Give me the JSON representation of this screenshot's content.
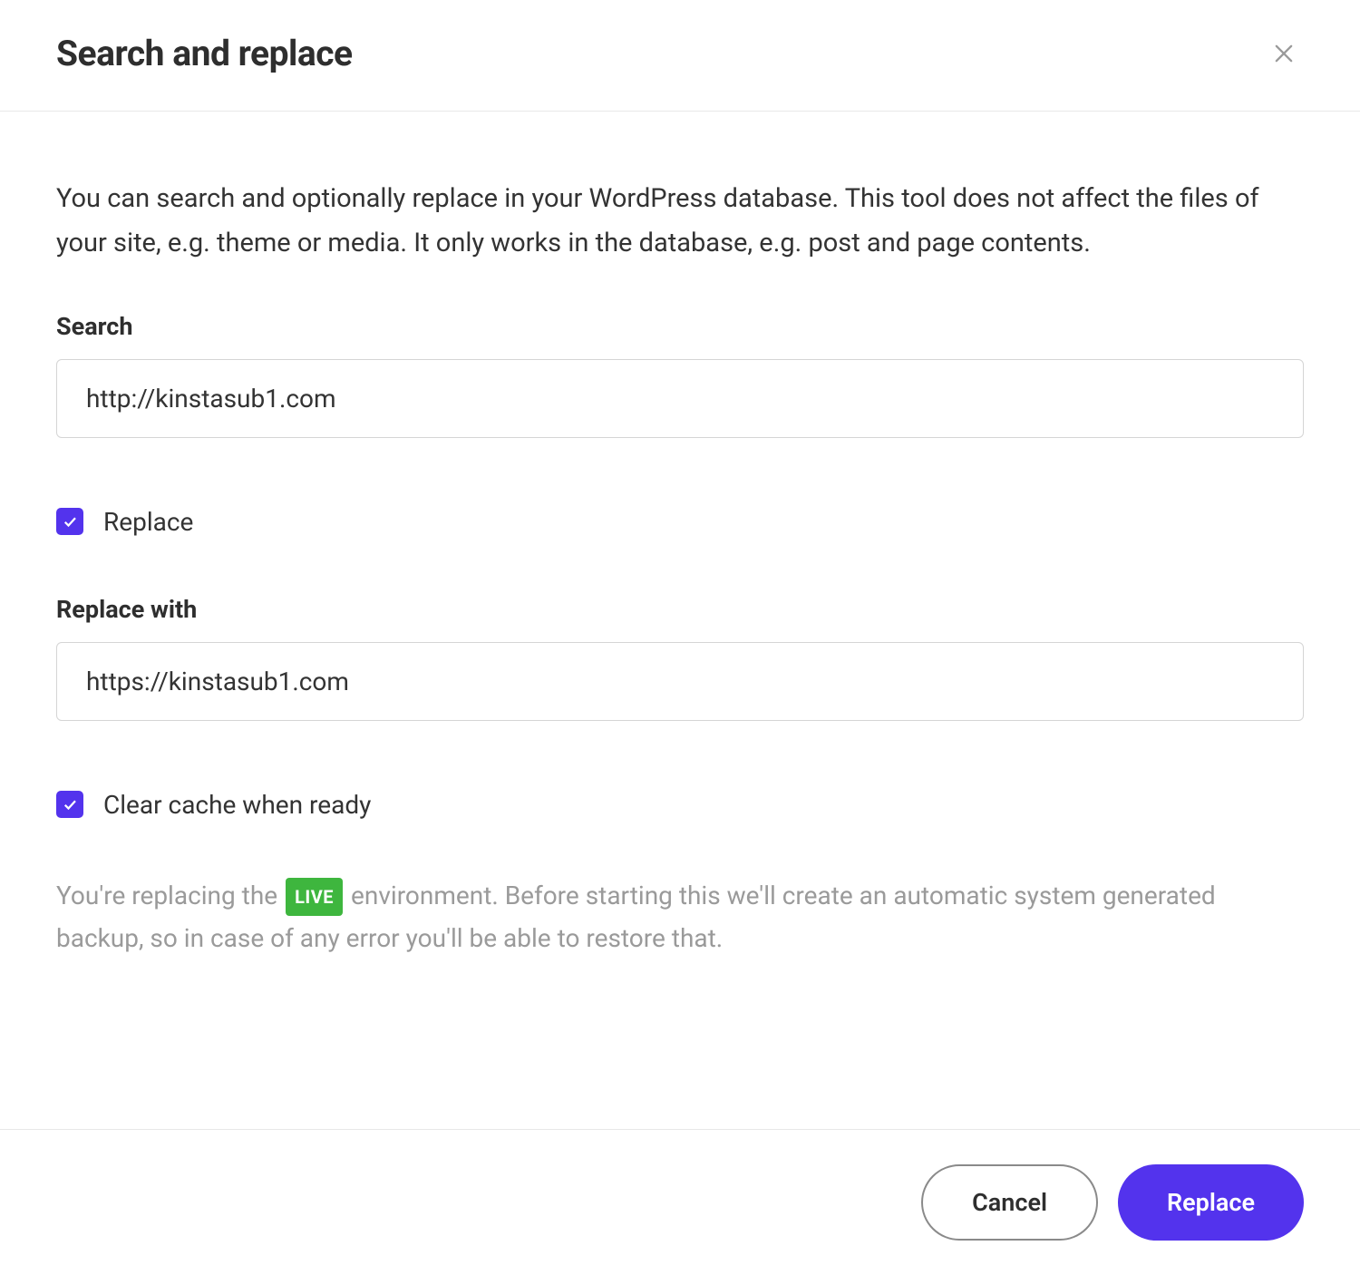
{
  "dialog": {
    "title": "Search and replace",
    "description": "You can search and optionally replace in your WordPress database. This tool does not affect the files of your site, e.g. theme or media. It only works in the database, e.g. post and page contents.",
    "search_label": "Search",
    "search_value": "http://kinstasub1.com",
    "replace_checkbox_label": "Replace",
    "replace_checkbox_checked": true,
    "replace_with_label": "Replace with",
    "replace_with_value": "https://kinstasub1.com",
    "clear_cache_label": "Clear cache when ready",
    "clear_cache_checked": true,
    "info_prefix": "You're replacing the ",
    "live_badge": "LIVE",
    "info_suffix": " environment. Before starting this we'll create an automatic system generated backup, so in case of any error you'll be able to restore that.",
    "cancel_button": "Cancel",
    "replace_button": "Replace"
  },
  "colors": {
    "accent": "#5333ED",
    "live_badge": "#3EB63E"
  }
}
